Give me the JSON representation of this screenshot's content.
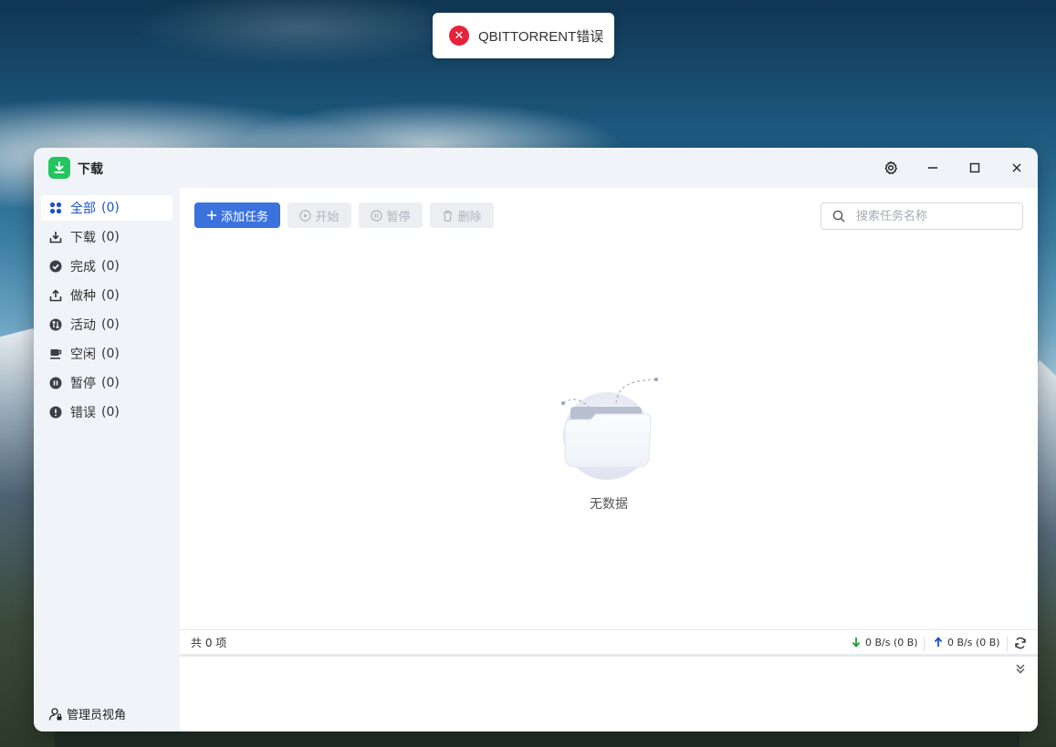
{
  "toast": {
    "icon": "error-circle-icon",
    "message": "QBITTORRENT错误",
    "color": "#e5233d"
  },
  "window": {
    "title": "下载",
    "app_icon": "download-icon",
    "accent": "#22c55e"
  },
  "titlebar": {
    "settings": "gear-icon",
    "minimize": "minimize-icon",
    "maximize": "maximize-icon",
    "close": "close-icon"
  },
  "sidebar": {
    "items": [
      {
        "id": "all",
        "label": "全部",
        "count": "(0)",
        "icon": "grid-icon",
        "active": true
      },
      {
        "id": "downloading",
        "label": "下载",
        "count": "(0)",
        "icon": "download-tray-icon"
      },
      {
        "id": "completed",
        "label": "完成",
        "count": "(0)",
        "icon": "check-circle-icon"
      },
      {
        "id": "seeding",
        "label": "做种",
        "count": "(0)",
        "icon": "upload-tray-icon"
      },
      {
        "id": "active",
        "label": "活动",
        "count": "(0)",
        "icon": "activity-icon"
      },
      {
        "id": "idle",
        "label": "空闲",
        "count": "(0)",
        "icon": "coffee-icon"
      },
      {
        "id": "paused",
        "label": "暂停",
        "count": "(0)",
        "icon": "pause-circle-icon"
      },
      {
        "id": "error",
        "label": "错误",
        "count": "(0)",
        "icon": "alert-circle-icon"
      }
    ],
    "admin_label": "管理员视角"
  },
  "toolbar": {
    "add_label": "添加任务",
    "start_label": "开始",
    "pause_label": "暂停",
    "delete_label": "删除",
    "accent": "#3b72dd"
  },
  "search": {
    "placeholder": "搜索任务名称",
    "value": ""
  },
  "empty": {
    "text": "无数据"
  },
  "status": {
    "total": "共 0 项",
    "download_speed": "0 B/s (0 B)",
    "upload_speed": "0 B/s (0 B)",
    "download_color": "#1f9d3a",
    "upload_color": "#1e50c8"
  }
}
